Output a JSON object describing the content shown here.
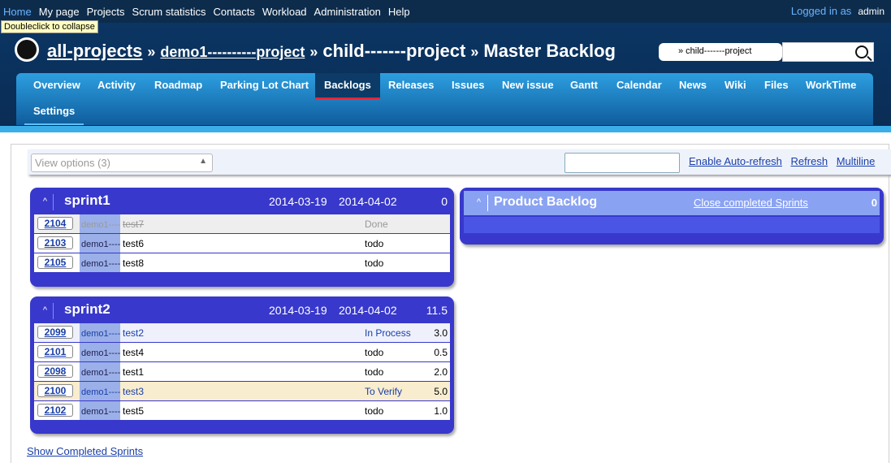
{
  "top_menu": {
    "items": [
      "Home",
      "My page",
      "Projects",
      "Scrum statistics",
      "Contacts",
      "Workload",
      "Administration",
      "Help"
    ],
    "logged_in_label": "Logged in as",
    "user": "admin"
  },
  "tooltip": "Doubleclick to collapse",
  "header": {
    "breadcrumb": [
      "all-projects",
      "demo1----------project",
      "child-------project",
      "Master Backlog"
    ],
    "separator": "»",
    "jump_to": "» child-------project"
  },
  "main_menu": {
    "tabs": [
      "Overview",
      "Activity",
      "Roadmap",
      "Parking Lot Chart",
      "Backlogs",
      "Releases",
      "Issues",
      "New issue",
      "Gantt",
      "Calendar",
      "News",
      "Wiki",
      "Files",
      "WorkTime",
      "Settings"
    ],
    "selected": "Backlogs"
  },
  "toolbar": {
    "view_options": "View options (3)",
    "links": [
      "Enable Auto-refresh",
      "Refresh",
      "Multiline"
    ]
  },
  "sprints": [
    {
      "name": "sprint1",
      "start": "2014-03-19",
      "end": "2014-04-02",
      "points": "0",
      "stories": [
        {
          "id": "2104",
          "project": "demo1----",
          "subject": "test7",
          "status": "Done",
          "points": ""
        },
        {
          "id": "2103",
          "project": "demo1----",
          "subject": "test6",
          "status": "todo",
          "points": ""
        },
        {
          "id": "2105",
          "project": "demo1----",
          "subject": "test8",
          "status": "todo",
          "points": ""
        }
      ]
    },
    {
      "name": "sprint2",
      "start": "2014-03-19",
      "end": "2014-04-02",
      "points": "11.5",
      "stories": [
        {
          "id": "2099",
          "project": "demo1----",
          "subject": "test2",
          "status": "In Process",
          "points": "3.0"
        },
        {
          "id": "2101",
          "project": "demo1----",
          "subject": "test4",
          "status": "todo",
          "points": "0.5"
        },
        {
          "id": "2098",
          "project": "demo1----",
          "subject": "test1",
          "status": "todo",
          "points": "2.0"
        },
        {
          "id": "2100",
          "project": "demo1----",
          "subject": "test3",
          "status": "To Verify",
          "points": "5.0"
        },
        {
          "id": "2102",
          "project": "demo1----",
          "subject": "test5",
          "status": "todo",
          "points": "1.0"
        }
      ]
    }
  ],
  "product_backlog": {
    "title": "Product Backlog",
    "close_link": "Close completed Sprints",
    "points": "0"
  },
  "show_completed": "Show Completed Sprints",
  "colors": {
    "header_bg": "#0b3563",
    "sprint_bg": "#3838cc",
    "product_backlog_header": "#8aa2f2",
    "link": "#1a3fa8"
  }
}
